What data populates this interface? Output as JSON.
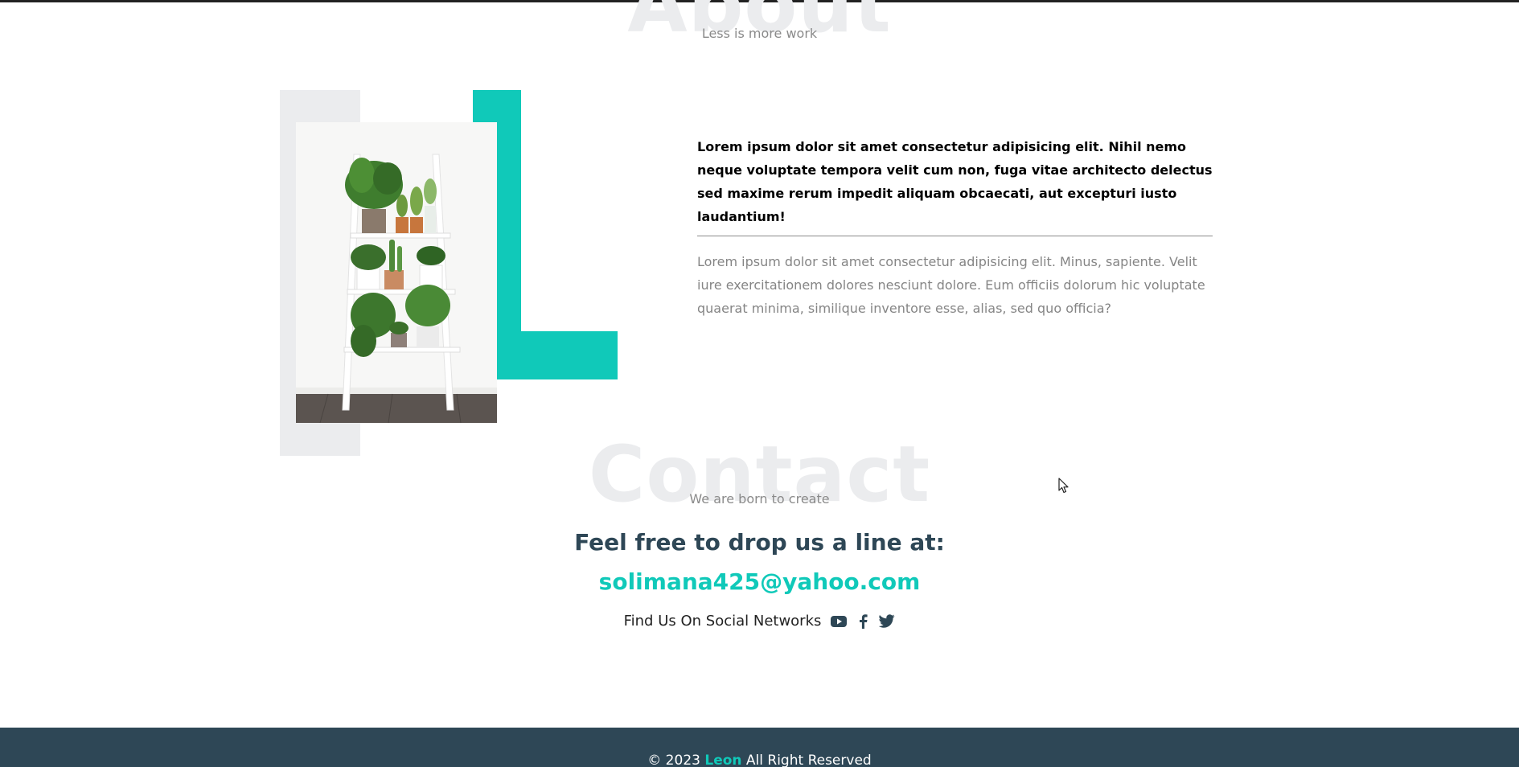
{
  "about": {
    "watermark": "About",
    "subtitle": "Less is more work",
    "lead": "Lorem ipsum dolor sit amet consectetur adipisicing elit. Nihil nemo neque voluptate tempora velit cum non, fuga vitae architecto delectus sed maxime rerum impedit aliquam obcaecati, aut excepturi iusto laudantium!",
    "body": "Lorem ipsum dolor sit amet consectetur adipisicing elit. Minus, sapiente. Velit iure exercitationem dolores nesciunt dolore. Eum officiis dolorum hic voluptate quaerat minima, similique inventore esse, alias, sed quo officia?"
  },
  "contact": {
    "watermark": "Contact",
    "subtitle": "We are born to create",
    "heading": "Feel free to drop us a line at:",
    "email": "solimana425@yahoo.com",
    "social_label": "Find Us On Social Networks",
    "social_icons": [
      "youtube-icon",
      "facebook-icon",
      "twitter-icon"
    ]
  },
  "footer": {
    "prefix": "© 2023",
    "brand": "Leon",
    "suffix": "All Right Reserved"
  },
  "colors": {
    "accent": "#10c9b9",
    "dark": "#2e4756",
    "watermark": "#ebecee",
    "muted": "#858585"
  }
}
